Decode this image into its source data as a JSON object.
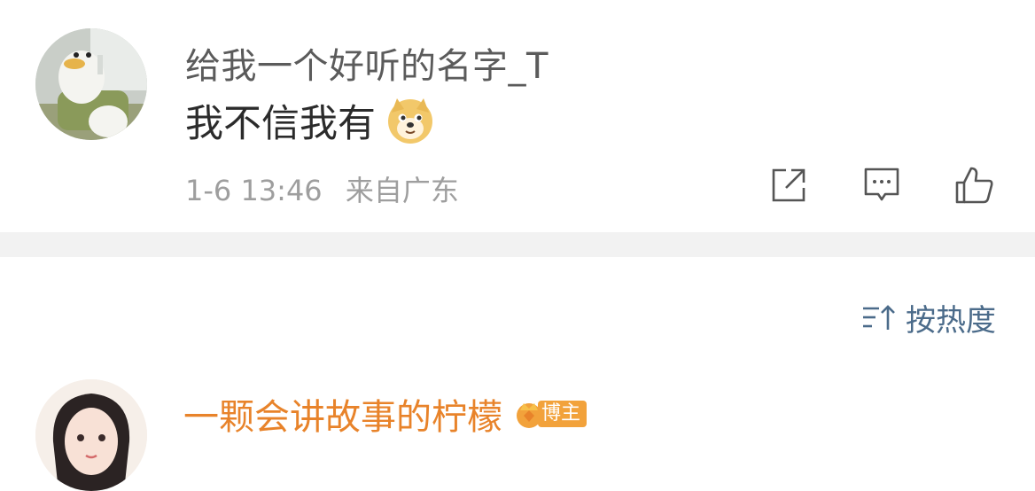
{
  "comments": [
    {
      "username": "给我一个好听的名字_T",
      "text": "我不信我有",
      "emoji": "doge-emoji",
      "date": "1-6 13:46",
      "location": "来自广东"
    },
    {
      "username": "一颗会讲故事的柠檬",
      "badge": "博主"
    }
  ],
  "sort": {
    "label": "按热度",
    "icon": "sort-icon"
  },
  "actions": {
    "share_icon": "share-icon",
    "reply_icon": "comment-icon",
    "like_icon": "thumbs-up-icon"
  },
  "colors": {
    "username_gray": "#5b5b5b",
    "author_orange": "#e8832a",
    "sort_blue": "#4b6b8a",
    "meta_gray": "#9e9e9e",
    "badge_orange": "#f2a23b"
  }
}
